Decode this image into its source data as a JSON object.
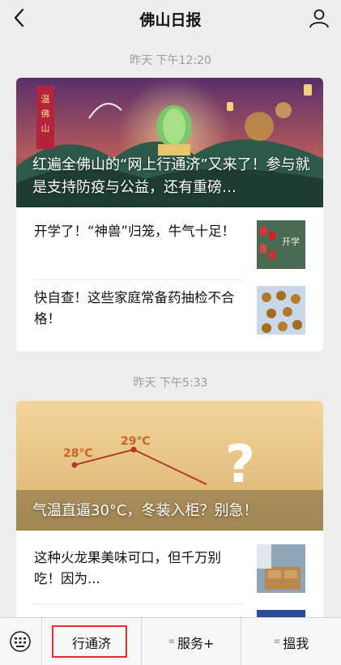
{
  "header": {
    "title": "佛山日报"
  },
  "groups": [
    {
      "time": "昨天 下午12:20",
      "cover_title": "红遍全佛山的“网上行通济”又来了！参与就是支持防疫与公益，还有重磅…",
      "items": [
        {
          "title": "开学了！“神兽”归笼，牛气十足！"
        },
        {
          "title": "快自查！这些家庭常备药抽检不合格！"
        }
      ]
    },
    {
      "time": "昨天 下午5:33",
      "cover_title": "气温直逼30°C，冬装入柜？别急！",
      "cover_labels": {
        "t1": "28℃",
        "t2": "29℃",
        "q": "?"
      },
      "items": [
        {
          "title": "这种火龙果美味可口，但千万别吃！因为..."
        }
      ]
    }
  ],
  "bottom_menu": {
    "items": [
      "行通济",
      "服务+",
      "搵我"
    ]
  },
  "colors": {
    "accent_red": "#e0312e",
    "bg": "#ededed"
  }
}
